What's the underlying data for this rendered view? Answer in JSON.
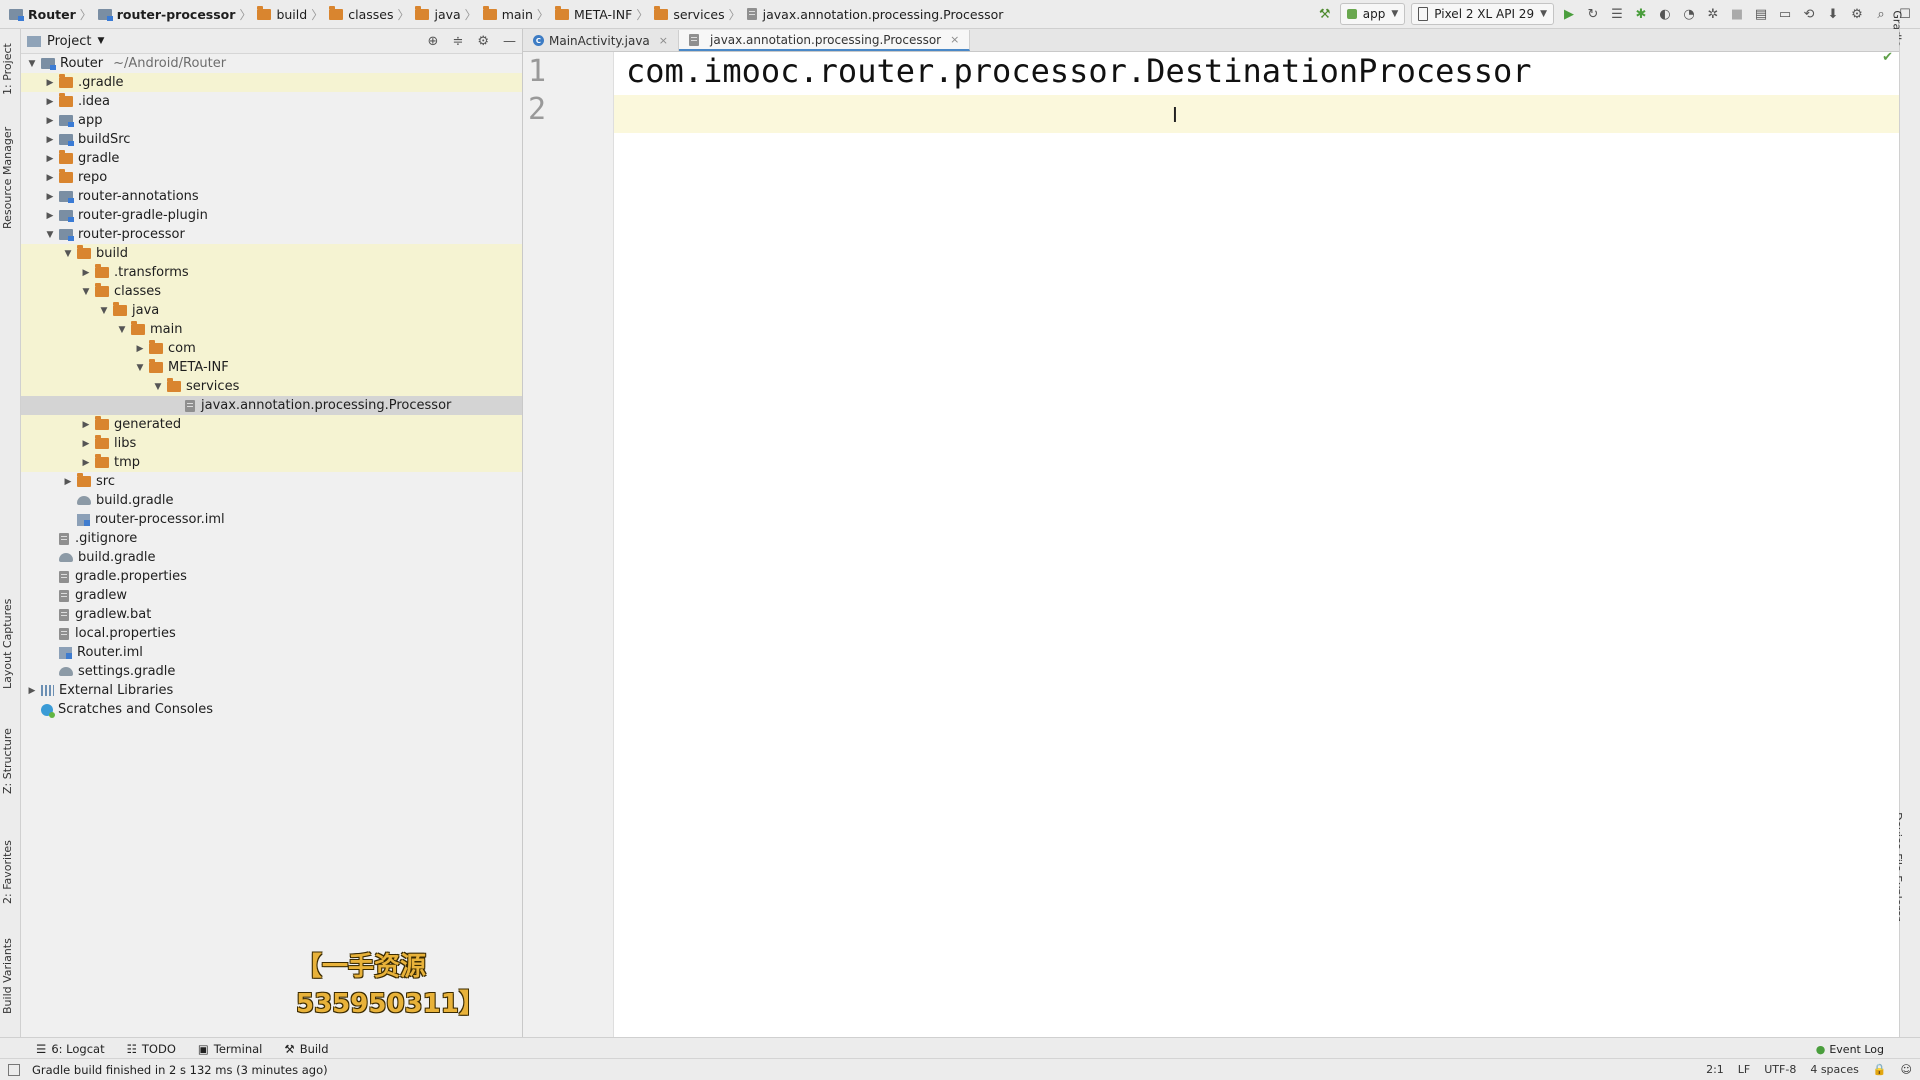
{
  "navbar": {
    "breadcrumbs": [
      "Router",
      "router-processor",
      "build",
      "classes",
      "java",
      "main",
      "META-INF",
      "services",
      "javax.annotation.processing.Processor"
    ],
    "run_config": "app",
    "device": "Pixel 2 XL API 29"
  },
  "left_stripe": {
    "project": "1: Project",
    "resource_manager": "Resource Manager",
    "layout_captures": "Layout Captures",
    "structure": "Z: Structure",
    "favorites": "2: Favorites",
    "build_variants": "Build Variants"
  },
  "right_stripe": {
    "gradle": "Gradle",
    "device_file_explorer": "Device File Explorer"
  },
  "project_panel": {
    "title": "Project",
    "tree": [
      {
        "label": "Router",
        "path": "~/Android/Router",
        "depth": 0,
        "arrow": "down",
        "icon": "module-icon",
        "hl": false
      },
      {
        "label": ".gradle",
        "depth": 1,
        "arrow": "right",
        "icon": "folder-icon",
        "hl": true
      },
      {
        "label": ".idea",
        "depth": 1,
        "arrow": "right",
        "icon": "folder-icon",
        "hl": false
      },
      {
        "label": "app",
        "depth": 1,
        "arrow": "right",
        "icon": "module-icon",
        "hl": false
      },
      {
        "label": "buildSrc",
        "depth": 1,
        "arrow": "right",
        "icon": "module-icon",
        "hl": false
      },
      {
        "label": "gradle",
        "depth": 1,
        "arrow": "right",
        "icon": "folder-icon",
        "hl": false
      },
      {
        "label": "repo",
        "depth": 1,
        "arrow": "right",
        "icon": "folder-icon",
        "hl": false
      },
      {
        "label": "router-annotations",
        "depth": 1,
        "arrow": "right",
        "icon": "module-icon",
        "hl": false
      },
      {
        "label": "router-gradle-plugin",
        "depth": 1,
        "arrow": "right",
        "icon": "module-icon",
        "hl": false
      },
      {
        "label": "router-processor",
        "depth": 1,
        "arrow": "down",
        "icon": "module-icon",
        "hl": false
      },
      {
        "label": "build",
        "depth": 2,
        "arrow": "down",
        "icon": "folder-icon",
        "hl": true
      },
      {
        "label": ".transforms",
        "depth": 3,
        "arrow": "right",
        "icon": "folder-icon",
        "hl": true
      },
      {
        "label": "classes",
        "depth": 3,
        "arrow": "down",
        "icon": "folder-icon",
        "hl": true
      },
      {
        "label": "java",
        "depth": 4,
        "arrow": "down",
        "icon": "folder-icon",
        "hl": true
      },
      {
        "label": "main",
        "depth": 5,
        "arrow": "down",
        "icon": "folder-icon",
        "hl": true
      },
      {
        "label": "com",
        "depth": 6,
        "arrow": "right",
        "icon": "folder-icon",
        "hl": true
      },
      {
        "label": "META-INF",
        "depth": 6,
        "arrow": "down",
        "icon": "folder-icon",
        "hl": true
      },
      {
        "label": "services",
        "depth": 7,
        "arrow": "down",
        "icon": "folder-icon",
        "hl": true
      },
      {
        "label": "javax.annotation.processing.Processor",
        "depth": 8,
        "arrow": "",
        "icon": "file-icon",
        "hl": false,
        "selected": true
      },
      {
        "label": "generated",
        "depth": 3,
        "arrow": "right",
        "icon": "folder-icon",
        "hl": true
      },
      {
        "label": "libs",
        "depth": 3,
        "arrow": "right",
        "icon": "folder-icon",
        "hl": true
      },
      {
        "label": "tmp",
        "depth": 3,
        "arrow": "right",
        "icon": "folder-icon",
        "hl": true
      },
      {
        "label": "src",
        "depth": 2,
        "arrow": "right",
        "icon": "folder-icon",
        "hl": false
      },
      {
        "label": "build.gradle",
        "depth": 2,
        "arrow": "",
        "icon": "gradle-icon",
        "hl": false
      },
      {
        "label": "router-processor.iml",
        "depth": 2,
        "arrow": "",
        "icon": "iml-icon",
        "hl": false
      },
      {
        "label": ".gitignore",
        "depth": 1,
        "arrow": "",
        "icon": "file-icon",
        "hl": false
      },
      {
        "label": "build.gradle",
        "depth": 1,
        "arrow": "",
        "icon": "gradle-icon",
        "hl": false
      },
      {
        "label": "gradle.properties",
        "depth": 1,
        "arrow": "",
        "icon": "file-icon",
        "hl": false
      },
      {
        "label": "gradlew",
        "depth": 1,
        "arrow": "",
        "icon": "file-icon",
        "hl": false
      },
      {
        "label": "gradlew.bat",
        "depth": 1,
        "arrow": "",
        "icon": "file-icon",
        "hl": false
      },
      {
        "label": "local.properties",
        "depth": 1,
        "arrow": "",
        "icon": "file-icon",
        "hl": false
      },
      {
        "label": "Router.iml",
        "depth": 1,
        "arrow": "",
        "icon": "iml-icon",
        "hl": false
      },
      {
        "label": "settings.gradle",
        "depth": 1,
        "arrow": "",
        "icon": "gradle-icon",
        "hl": false
      },
      {
        "label": "External Libraries",
        "depth": 0,
        "arrow": "right",
        "icon": "library-icon",
        "hl": false
      },
      {
        "label": "Scratches and Consoles",
        "depth": 0,
        "arrow": "",
        "icon": "scratch-icon",
        "hl": false
      }
    ]
  },
  "watermark": "【一手资源535950311】",
  "editor": {
    "tabs": [
      {
        "label": "MainActivity.java",
        "active": false
      },
      {
        "label": "javax.annotation.processing.Processor",
        "active": true
      }
    ],
    "lines": [
      {
        "number": "1",
        "text": "com.imooc.router.processor.DestinationProcessor"
      },
      {
        "number": "2",
        "text": ""
      }
    ]
  },
  "bottom_tools": [
    "6: Logcat",
    "TODO",
    "Terminal",
    "Build"
  ],
  "event_log": "Event Log",
  "status": {
    "message": "Gradle build finished in 2 s 132 ms (3 minutes ago)",
    "position": "2:1",
    "line_sep": "LF",
    "encoding": "UTF-8",
    "indent": "4 spaces"
  },
  "colors": {
    "highlight_row": "#f5f3d2",
    "selected_row": "#d4d4d4",
    "folder": "#d9852f",
    "current_line": "#fbf8dc"
  }
}
